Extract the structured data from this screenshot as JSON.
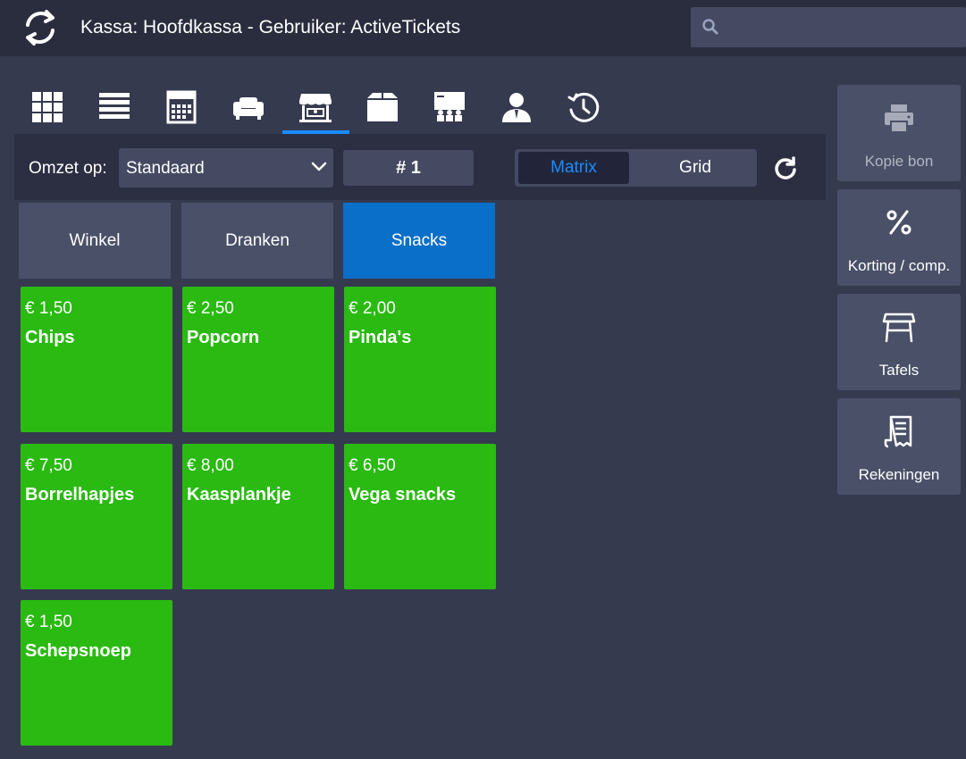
{
  "header": {
    "title": "Kassa: Hoofdkassa - Gebruiker: ActiveTickets",
    "search_placeholder": ""
  },
  "tabs": [
    {
      "icon": "grid-icon"
    },
    {
      "icon": "list-icon"
    },
    {
      "icon": "calendar-icon"
    },
    {
      "icon": "sofa-icon"
    },
    {
      "icon": "shop-icon",
      "active": true
    },
    {
      "icon": "box-icon"
    },
    {
      "icon": "presentation-icon"
    },
    {
      "icon": "user-icon"
    },
    {
      "icon": "history-clock-icon"
    }
  ],
  "toolbar": {
    "omzet_label": "Omzet op:",
    "omzet_value": "Standaard",
    "number_label": "# 1",
    "view_matrix": "Matrix",
    "view_grid": "Grid",
    "active_view": "Matrix"
  },
  "categories": [
    "Winkel",
    "Dranken",
    "Snacks"
  ],
  "active_category": "Snacks",
  "products": [
    {
      "price": "€ 1,50",
      "name": "Chips"
    },
    {
      "price": "€ 2,50",
      "name": "Popcorn"
    },
    {
      "price": "€ 2,00",
      "name": "Pinda's"
    },
    {
      "price": "€ 7,50",
      "name": "Borrelhapjes"
    },
    {
      "price": "€ 8,00",
      "name": "Kaasplankje"
    },
    {
      "price": "€ 6,50",
      "name": "Vega snacks"
    },
    {
      "price": "€ 1,50",
      "name": "Schepsnoep"
    }
  ],
  "side_buttons": [
    {
      "label": "Kopie bon",
      "icon": "printer-icon",
      "disabled": true
    },
    {
      "label": "Korting / comp.",
      "icon": "percent-icon"
    },
    {
      "label": "Tafels",
      "icon": "table-icon"
    },
    {
      "label": "Rekeningen",
      "icon": "receipt-icon"
    }
  ],
  "colors": {
    "background": "#363a4f",
    "header": "#2a2d3e",
    "accent": "#1a8cff",
    "active_category": "#0a6fc8",
    "product_tile": "#2aba12",
    "button": "#4a5068"
  }
}
